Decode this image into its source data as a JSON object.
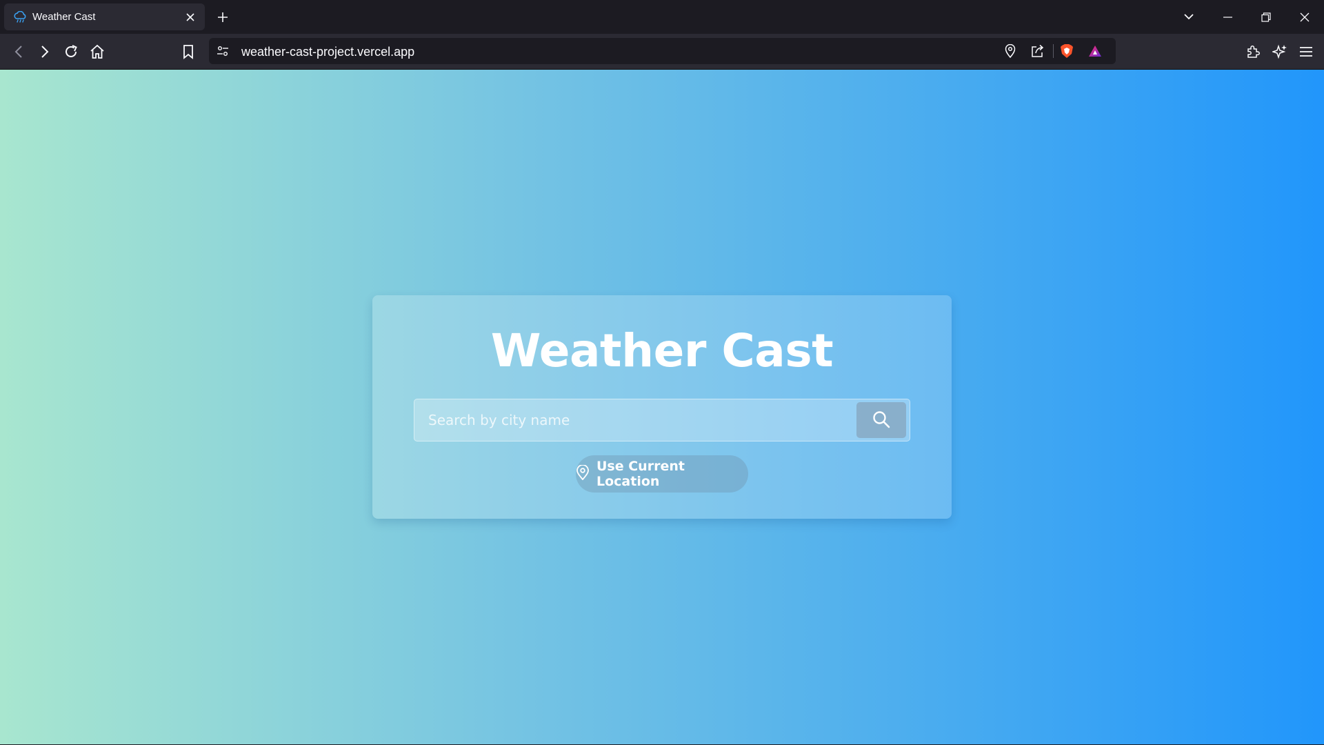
{
  "browser": {
    "tab": {
      "title": "Weather Cast",
      "icon": "cloud-rain-icon"
    },
    "url": "weather-cast-project.vercel.app"
  },
  "page": {
    "title": "Weather Cast",
    "search": {
      "placeholder": "Search by city name",
      "value": ""
    },
    "location_button": {
      "label": "Use Current Location"
    }
  },
  "colors": {
    "gradient_start": "#a8e6cf",
    "gradient_end": "#2196fb",
    "title_text": "#ffffff"
  }
}
